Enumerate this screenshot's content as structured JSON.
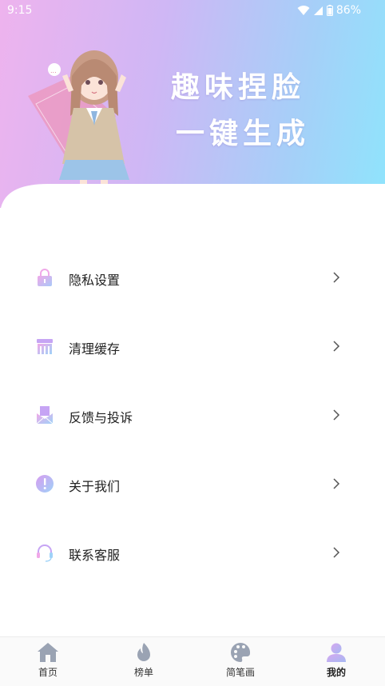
{
  "status_bar": {
    "time": "9:15",
    "battery": "86%",
    "icons": [
      "wifi-icon",
      "signal-icon",
      "battery-icon"
    ]
  },
  "header": {
    "slogan_line1": "趣味捏脸",
    "slogan_line2": "一键生成",
    "illustration": "anime-girl-illustration"
  },
  "menu": {
    "items": [
      {
        "label": "隐私设置",
        "icon": "lock-icon"
      },
      {
        "label": "清理缓存",
        "icon": "broom-icon"
      },
      {
        "label": "反馈与投诉",
        "icon": "mail-icon"
      },
      {
        "label": "关于我们",
        "icon": "info-icon"
      },
      {
        "label": "联系客服",
        "icon": "headset-icon"
      }
    ]
  },
  "tabbar": {
    "tabs": [
      {
        "label": "首页",
        "icon": "home-icon"
      },
      {
        "label": "榜单",
        "icon": "flame-icon"
      },
      {
        "label": "简笔画",
        "icon": "palette-icon"
      },
      {
        "label": "我的",
        "icon": "user-icon",
        "active": true
      }
    ]
  },
  "colors": {
    "gradient_start": "#eeb3ee",
    "gradient_end": "#8fe4fc",
    "icon_pink": "#f0a8e8",
    "icon_purple": "#c6a4f4",
    "icon_blue": "#9fd2f8",
    "tab_icon_gray": "#9aa3b3",
    "tab_icon_active": "#c3a8f2"
  }
}
